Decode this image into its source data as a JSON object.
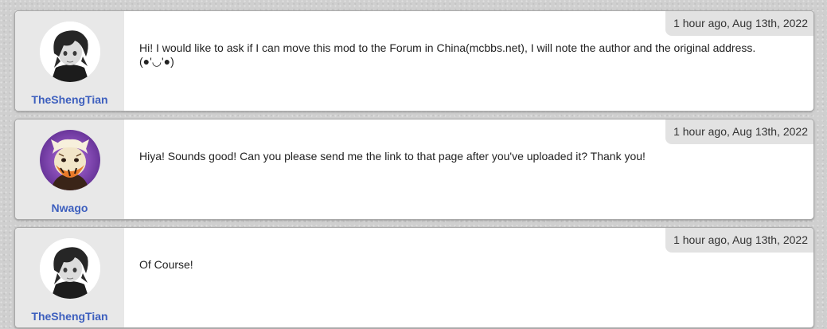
{
  "comments": [
    {
      "author": "TheShengTian",
      "avatar_icon": "dark-haired-character-avatar-icon",
      "timestamp": "1 hour ago, Aug 13th, 2022",
      "text": "Hi! I would like to ask if I can move this mod to the Forum in China(mcbbs.net), I will note the author and the original address. (●'◡'●)"
    },
    {
      "author": "Nwago",
      "avatar_icon": "tiger-character-avatar-icon",
      "timestamp": "1 hour ago, Aug 13th, 2022",
      "text": "Hiya! Sounds good! Can you please send me the link to that page after you've uploaded it? Thank you!"
    },
    {
      "author": "TheShengTian",
      "avatar_icon": "dark-haired-character-avatar-icon",
      "timestamp": "1 hour ago, Aug 13th, 2022",
      "text": "Of Course!"
    }
  ],
  "colors": {
    "author_link": "#3d5fbe",
    "author_panel_bg": "#e8e8e8",
    "timestamp_bg": "#e2e2e2",
    "page_bg": "#cfcfcf"
  }
}
